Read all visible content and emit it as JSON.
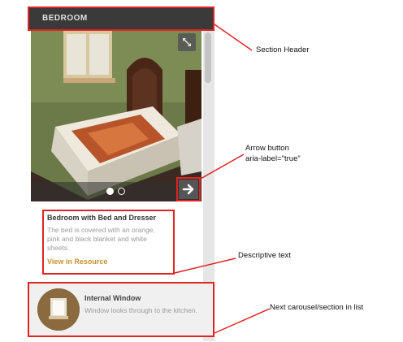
{
  "section": {
    "title": "BEDROOM"
  },
  "carousel": {
    "expand_icon": "expand-arrows-icon",
    "next_icon": "arrow-right-icon",
    "indicator": {
      "total": 2,
      "active": 1
    }
  },
  "item": {
    "title": "Bedroom with Bed and Dresser",
    "description": "The bed is covered with an orange, pink and black blanket and white sheets.",
    "link": "View in Resource"
  },
  "next_item": {
    "title": "Internal Window",
    "description": "Window looks through to the kitchen."
  },
  "annotations": {
    "section_header": "Section Header",
    "arrow_button_line1": "Arrow button",
    "arrow_button_line2": "aria-label=\"true\"",
    "descriptive_text": "Descriptive text",
    "next_carousel": "Next carousel/section in list"
  },
  "colors": {
    "header_bg": "#3a3a3a",
    "link": "#c8912e",
    "annotation_red": "#e02424"
  }
}
